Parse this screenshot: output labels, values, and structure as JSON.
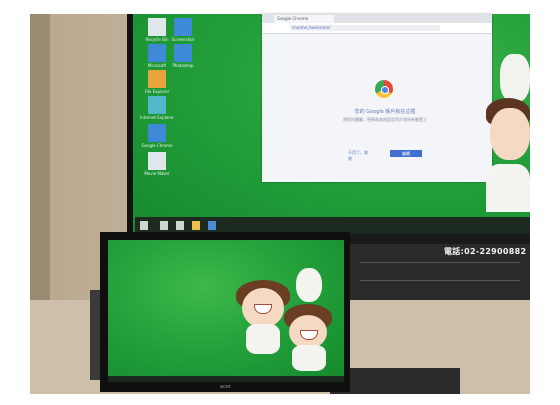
{
  "scene": {
    "description_tags": [
      "wall-tv-display",
      "desktop-monitor",
      "green-wallpaper-cartoon"
    ],
    "colors": {
      "wallpaper_green": "#23a03a",
      "chrome_button": "#3f6fd1"
    }
  },
  "tv": {
    "desktop_icons": [
      {
        "label": "Recycle Bin",
        "icon": "recycle-bin-icon"
      },
      {
        "label": "Screenshot",
        "icon": "app-icon"
      },
      {
        "label": "Microsoft",
        "icon": "app-icon"
      },
      {
        "label": "Photoshop",
        "icon": "app-icon"
      },
      {
        "label": "File Explorer",
        "icon": "folder-icon"
      },
      {
        "label": "Internet Explorer",
        "icon": "ie-icon"
      },
      {
        "label": "Google Chrome",
        "icon": "chrome-icon"
      },
      {
        "label": "Movie Maker",
        "icon": "app-icon"
      }
    ],
    "browser": {
      "tab_title": "Google Chrome",
      "url": "chrome://welcome/",
      "heading": "您的 Google 帳戶就在這裡",
      "body": "將您的書籤、密碼和其他設定同步到所有裝置上",
      "secondary_button": "不用了，謝謝",
      "primary_button": "繼續"
    }
  },
  "cabinet": {
    "phone_text": "電話:02-22900882"
  },
  "monitor": {
    "brand": "acer"
  }
}
